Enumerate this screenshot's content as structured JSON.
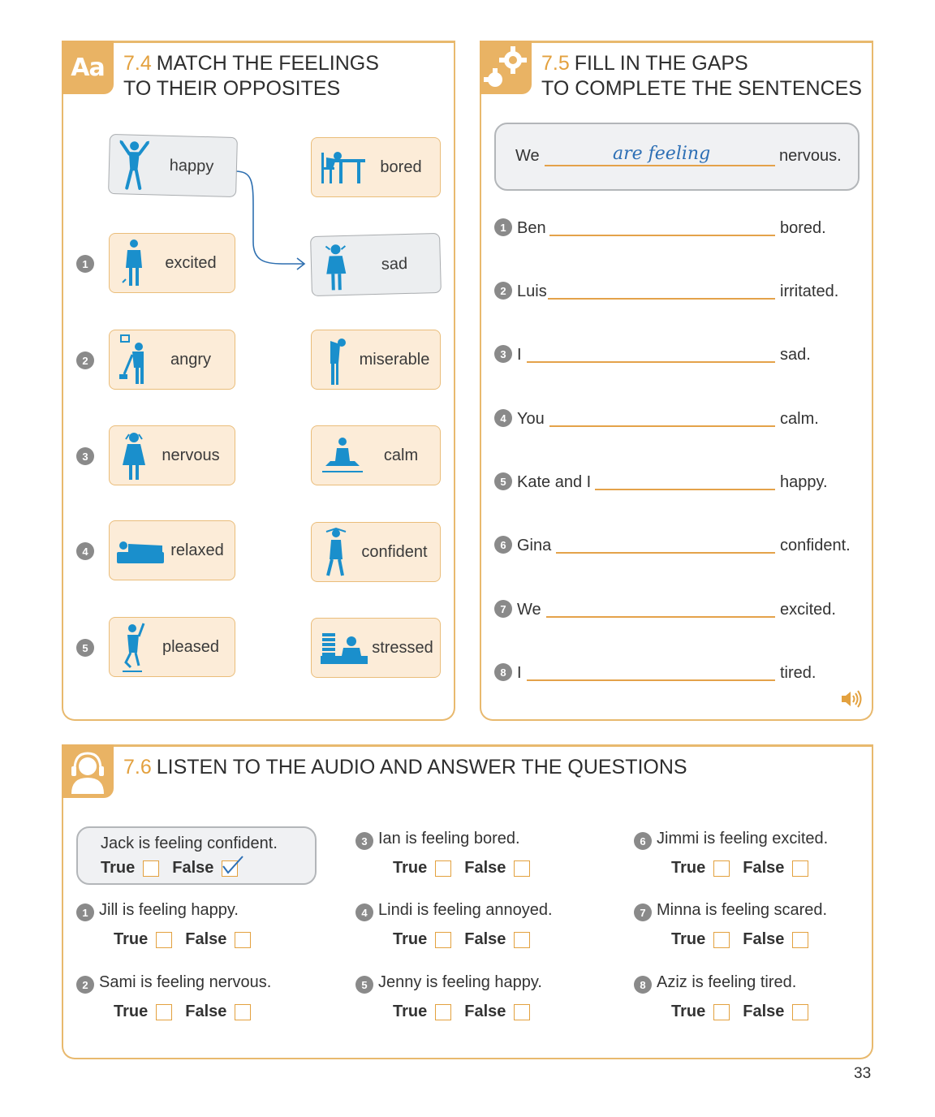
{
  "ex74": {
    "badge": "Aa",
    "num": "7.4",
    "title_line1": "MATCH THE FEELINGS",
    "title_line2": "TO THEIR OPPOSITES",
    "example_left": {
      "word": "happy",
      "icon": "person-jumping-icon"
    },
    "example_right": {
      "word": "sad",
      "icon": "person-crying-icon"
    },
    "left": [
      {
        "num": "1",
        "word": "excited",
        "icon": "person-excited-icon"
      },
      {
        "num": "2",
        "word": "angry",
        "icon": "person-angry-icon"
      },
      {
        "num": "3",
        "word": "nervous",
        "icon": "person-nervous-icon"
      },
      {
        "num": "4",
        "word": "relaxed",
        "icon": "person-lying-icon"
      },
      {
        "num": "5",
        "word": "pleased",
        "icon": "person-pleased-icon"
      }
    ],
    "right": [
      {
        "word": "bored",
        "icon": "person-at-desk-icon"
      },
      {
        "word": "miserable",
        "icon": "person-slumped-icon"
      },
      {
        "word": "calm",
        "icon": "person-meditating-icon"
      },
      {
        "word": "confident",
        "icon": "person-confident-icon"
      },
      {
        "word": "stressed",
        "icon": "person-stressed-icon"
      }
    ]
  },
  "ex75": {
    "num": "7.5",
    "title_line1": "FILL IN THE GAPS",
    "title_line2": "TO COMPLETE THE SENTENCES",
    "example": {
      "subject": "We",
      "answer": "are feeling",
      "end": "nervous."
    },
    "items": [
      {
        "num": "1",
        "subject": "Ben",
        "end": "bored."
      },
      {
        "num": "2",
        "subject": "Luis",
        "end": "irritated."
      },
      {
        "num": "3",
        "subject": "I",
        "end": "sad."
      },
      {
        "num": "4",
        "subject": "You",
        "end": "calm."
      },
      {
        "num": "5",
        "subject": "Kate and I",
        "end": "happy."
      },
      {
        "num": "6",
        "subject": "Gina",
        "end": "confident."
      },
      {
        "num": "7",
        "subject": "We",
        "end": "excited."
      },
      {
        "num": "8",
        "subject": "I",
        "end": "tired."
      }
    ],
    "audio_icon": "speaker-icon"
  },
  "ex76": {
    "num": "7.6",
    "title": "LISTEN TO THE AUDIO AND ANSWER THE QUESTIONS",
    "badge_icon": "headphones-person-icon",
    "true_label": "True",
    "false_label": "False",
    "example": {
      "statement": "Jack is feeling confident.",
      "answer": "False"
    },
    "items": [
      {
        "num": "1",
        "statement": "Jill is feeling happy."
      },
      {
        "num": "2",
        "statement": "Sami is feeling nervous."
      },
      {
        "num": "3",
        "statement": "Ian is feeling bored."
      },
      {
        "num": "4",
        "statement": "Lindi is feeling annoyed."
      },
      {
        "num": "5",
        "statement": "Jenny is feeling happy."
      },
      {
        "num": "6",
        "statement": "Jimmi is feeling excited."
      },
      {
        "num": "7",
        "statement": "Minna is feeling scared."
      },
      {
        "num": "8",
        "statement": "Aziz is feeling tired."
      }
    ]
  },
  "page_number": "33",
  "colors": {
    "accent": "#e9b364",
    "line": "#e4a24a",
    "icon_blue": "#1a8fcc",
    "answer_blue": "#2d6fb5"
  }
}
